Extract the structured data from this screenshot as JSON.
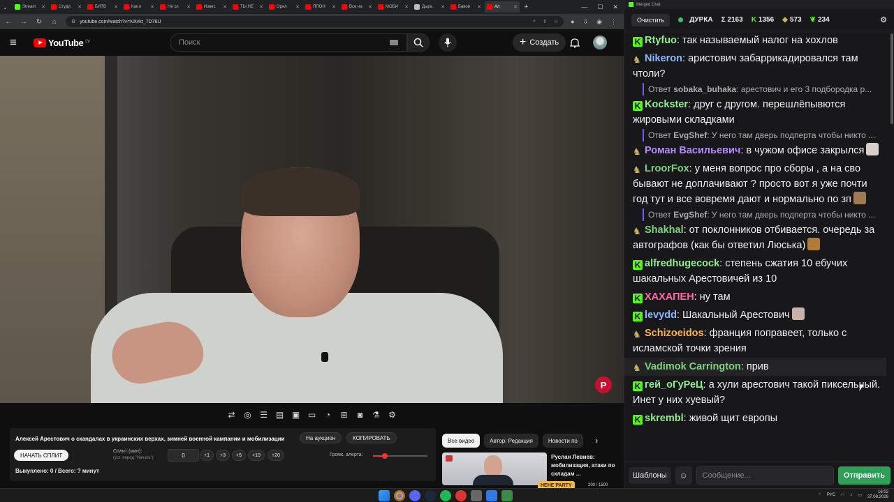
{
  "browser": {
    "tabs": [
      {
        "label": "Stream",
        "color": "#53fc18"
      },
      {
        "label": "Студи",
        "color": "#ff0000"
      },
      {
        "label": "БИТВ",
        "color": "#ff0000"
      },
      {
        "label": "Как н",
        "color": "#ff0000"
      },
      {
        "label": "Не сп",
        "color": "#ff0000"
      },
      {
        "label": "Извес",
        "color": "#ff0000"
      },
      {
        "label": "ТЫ НЕ",
        "color": "#ff0000"
      },
      {
        "label": "Орел",
        "color": "#ff0000"
      },
      {
        "label": "ЯПОН",
        "color": "#ff0000"
      },
      {
        "label": "Все на",
        "color": "#ff0000"
      },
      {
        "label": "МОБИ",
        "color": "#ff0000"
      },
      {
        "label": "Дыра",
        "color": "#bbbbbb"
      },
      {
        "label": "Бавов",
        "color": "#ff0000"
      },
      {
        "label": "Ал",
        "color": "#ff0000"
      }
    ],
    "new_tab": "+",
    "url": "youtube.com/watch?v=NXvkt_7D76U"
  },
  "youtube": {
    "logo": "YouTube",
    "region": "LV",
    "search_placeholder": "Поиск",
    "create_label": "Создать",
    "video_watermark": "P"
  },
  "auction": {
    "title": "Алексей Арестович о скандалах в украинских верхах, зимней военной кампании и мобилизации",
    "auction_btn": "На аукцион",
    "copy_btn": "КОПИРОВАТЬ",
    "split_btn": "НАЧАТЬ СПЛИТ",
    "split_label": "Сплит (мин):",
    "split_sub": "(уст. перед \"Начать\")",
    "split_value": "0",
    "increments": [
      "+1",
      "+3",
      "+5",
      "+10",
      "+20"
    ],
    "alert_label": "Громк. алерта:",
    "alert_volume": 0.22,
    "bought": "Выкуплено: 0 / Всего: ? минут"
  },
  "related": {
    "chips": [
      "Все видео",
      "Автор: Редакция",
      "Новости по"
    ],
    "title": "Руслан Левиев: мобилизация, атаки по складам ...",
    "party_badge": "НЕНЕ PARTY",
    "party_count": "200 / 1500"
  },
  "chat": {
    "window_title": "Merged Chat",
    "clear_btn": "Очистить",
    "channel": "ДУРКА",
    "stat_total": "Σ 2163",
    "stat_kick": "1356",
    "stat_twitch": "573",
    "stat_other": "234",
    "messages": [
      {
        "nick": "Rtyfuo",
        "color": "#90ee90",
        "badge": "k",
        "text": "так называемый налог на хохлов"
      },
      {
        "nick": "Nikeron",
        "color": "#8bb8ff",
        "badge": "t",
        "text": "аристович забаррикадировался там чтоли?"
      },
      {
        "reply_nick": "sobaka_buhaka",
        "reply_text": "арестович и его 3 подбородка р..."
      },
      {
        "nick": "Kockster",
        "color": "#90ee90",
        "badge": "k",
        "text": "друг с другом. перешлёпывются жировыми складками"
      },
      {
        "reply_nick": "EvgShef",
        "reply_text": "У него там дверь подперта чтобы никто ..."
      },
      {
        "nick": "Роман Васильевич",
        "color": "#b48cff",
        "badge": "t",
        "text": "в чужом офисе закрылся",
        "emote": "#d6d0c8"
      },
      {
        "nick": "LroorFox",
        "color": "#7fd37f",
        "badge": "t",
        "text": "у меня вопрос про сборы , а на сво бывают не доплачивают ? просто вот я уже почти год тут и все вовремя дают и нормально по зп",
        "emote": "#a07a55"
      },
      {
        "reply_nick": "EvgShef",
        "reply_text": "У него там дверь подперта чтобы никто ..."
      },
      {
        "nick": "Shakhal",
        "color": "#7fd37f",
        "badge": "t",
        "text": "от поклонников отбивается. очередь за автографов (как бы ответил Люська)",
        "emote": "#b07a3a"
      },
      {
        "nick": "alfredhugecock",
        "color": "#90ee90",
        "badge": "k",
        "text": "степень сжатия 10 ебучих шакальных Арестовичей из 10"
      },
      {
        "nick": "ХАХАПЕН",
        "color": "#ff6b9d",
        "badge": "k",
        "text": "ну там"
      },
      {
        "nick": "levydd",
        "color": "#8bb8ff",
        "badge": "k",
        "text": "Шакальный Арестович",
        "emote": "#c9b1a8"
      },
      {
        "nick": "Schizoeidos",
        "color": "#ffb347",
        "badge": "t",
        "text": "франция поправеет, только с исламской точки зрения"
      },
      {
        "nick": "Vadimok Carrington",
        "color": "#7fd37f",
        "badge": "t",
        "text": "прив",
        "highlight": true
      },
      {
        "nick": "гей_оГуРеЦ",
        "color": "#90ee90",
        "badge": "k",
        "text": "а хули арестович такой пиксельный. Инет у них хуевый?"
      },
      {
        "nick": "skrembl",
        "color": "#90ee90",
        "badge": "k",
        "text": "живой щит европы"
      }
    ],
    "templates_btn": "Шаблоны",
    "input_placeholder": "Сообщение...",
    "send_btn": "Отправить"
  },
  "taskbar": {
    "lang": "РУС",
    "time": "16:02",
    "date": "27.08.2026"
  }
}
